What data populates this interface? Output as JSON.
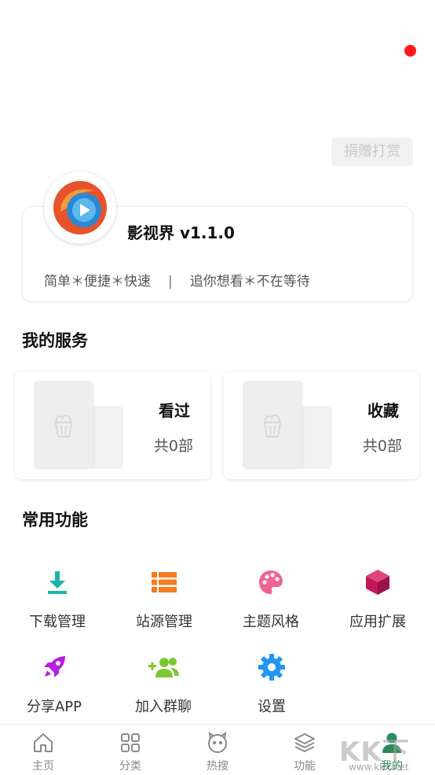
{
  "header": {
    "donate_label": "捐赠打赏"
  },
  "profile": {
    "app_name": "影视界 v1.1.0",
    "slogan_left": "简单＊便捷＊快速",
    "slogan_sep": "|",
    "slogan_right": "追你想看＊不在等待"
  },
  "services": {
    "title": "我的服务",
    "items": [
      {
        "name": "看过",
        "count": "共0部"
      },
      {
        "name": "收藏",
        "count": "共0部"
      }
    ]
  },
  "functions": {
    "title": "常用功能",
    "items": [
      {
        "label": "下载管理",
        "icon": "download-icon",
        "color": "#1bb5a8"
      },
      {
        "label": "站源管理",
        "icon": "list-icon",
        "color": "#f57c1f"
      },
      {
        "label": "主题风格",
        "icon": "palette-icon",
        "color": "#f06292"
      },
      {
        "label": "应用扩展",
        "icon": "cube-icon",
        "color": "#c2185b"
      },
      {
        "label": "分享APP",
        "icon": "rocket-icon",
        "color": "#b620e0"
      },
      {
        "label": "加入群聊",
        "icon": "add-group-icon",
        "color": "#7cc832"
      },
      {
        "label": "设置",
        "icon": "gear-icon",
        "color": "#2196f3"
      }
    ]
  },
  "bottom_nav": {
    "items": [
      {
        "label": "主页",
        "icon": "home-icon"
      },
      {
        "label": "分类",
        "icon": "grid-icon"
      },
      {
        "label": "热搜",
        "icon": "face-icon"
      },
      {
        "label": "功能",
        "icon": "layers-icon"
      },
      {
        "label": "我的",
        "icon": "user-icon"
      }
    ],
    "active_index": 4,
    "active_color": "#2a8a5a"
  },
  "watermark": {
    "text": "KK下载",
    "sub": "www.kkx.net"
  }
}
